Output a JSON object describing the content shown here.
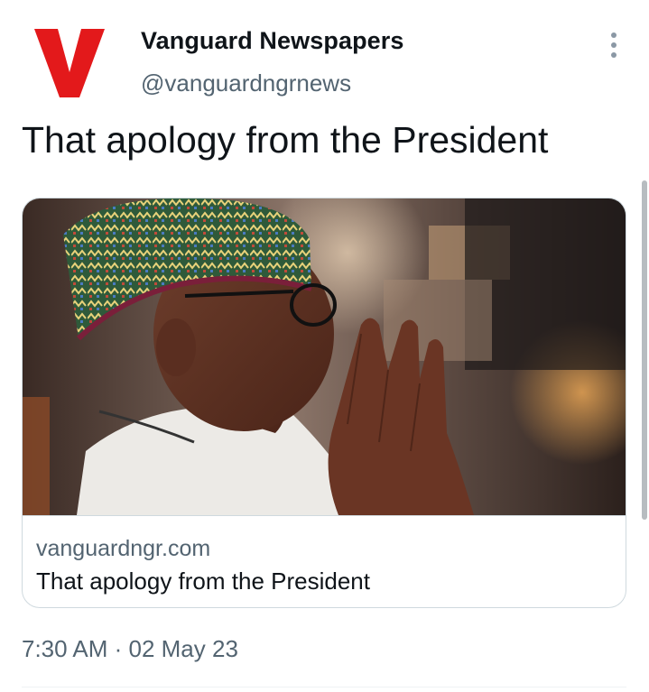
{
  "author": {
    "name": "Vanguard Newspapers",
    "handle": "@vanguardngrnews",
    "logo_letter": "V",
    "logo_color": "#e3191b"
  },
  "tweet": {
    "text": "That apology from the President",
    "timestamp": "7:30 AM · 02 May 23"
  },
  "link_card": {
    "domain": "vanguardngr.com",
    "title": "That apology from the President",
    "image_subject": "man in patterned cap and glasses with hands clasped"
  },
  "icons": {
    "more": "more-vertical-icon"
  },
  "colors": {
    "text_primary": "#0f1419",
    "text_secondary": "#536471",
    "border": "#cfd9de",
    "brand_red": "#e3191b"
  }
}
